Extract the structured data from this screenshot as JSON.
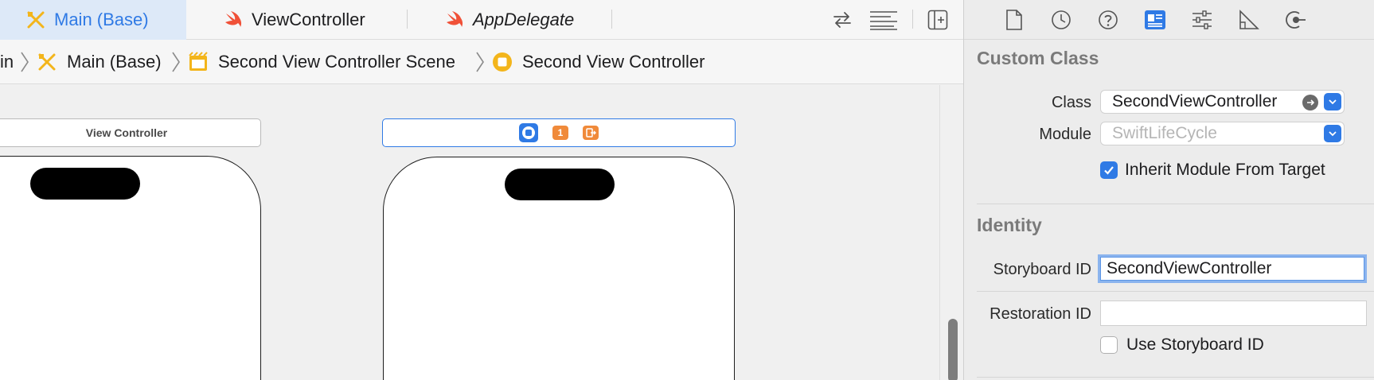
{
  "tabs": [
    {
      "label": "Main (Base)",
      "icon": "storyboard-icon",
      "active": true
    },
    {
      "label": "ViewController",
      "icon": "swift-icon",
      "active": false
    },
    {
      "label": "AppDelegate",
      "icon": "swift-icon",
      "active": false
    }
  ],
  "breadcrumb": {
    "items": [
      {
        "label": "in",
        "icon": ""
      },
      {
        "label": "Main (Base)",
        "icon": "storyboard-icon"
      },
      {
        "label": "Second View Controller Scene",
        "icon": "scene-icon"
      },
      {
        "label": "Second View Controller",
        "icon": "view-controller-icon"
      }
    ]
  },
  "canvas": {
    "left_scene_title": "View Controller",
    "right_scene_dock": [
      "view-controller-icon",
      "first-responder-icon",
      "exit-icon"
    ],
    "first_responder_badge": "1"
  },
  "inspector": {
    "custom_class": {
      "title": "Custom Class",
      "class_label": "Class",
      "class_value": "SecondViewController",
      "module_label": "Module",
      "module_placeholder": "SwiftLifeCycle",
      "inherit_label": "Inherit Module From Target",
      "inherit_checked": true
    },
    "identity": {
      "title": "Identity",
      "storyboard_id_label": "Storyboard ID",
      "storyboard_id_value": "SecondViewController",
      "restoration_id_label": "Restoration ID",
      "restoration_id_value": "",
      "use_storyboard_id_label": "Use Storyboard ID",
      "use_storyboard_id_checked": false
    }
  },
  "colors": {
    "accent": "#2f7ae5",
    "swift": "#f05138",
    "storyboard": "#f3b51b"
  }
}
